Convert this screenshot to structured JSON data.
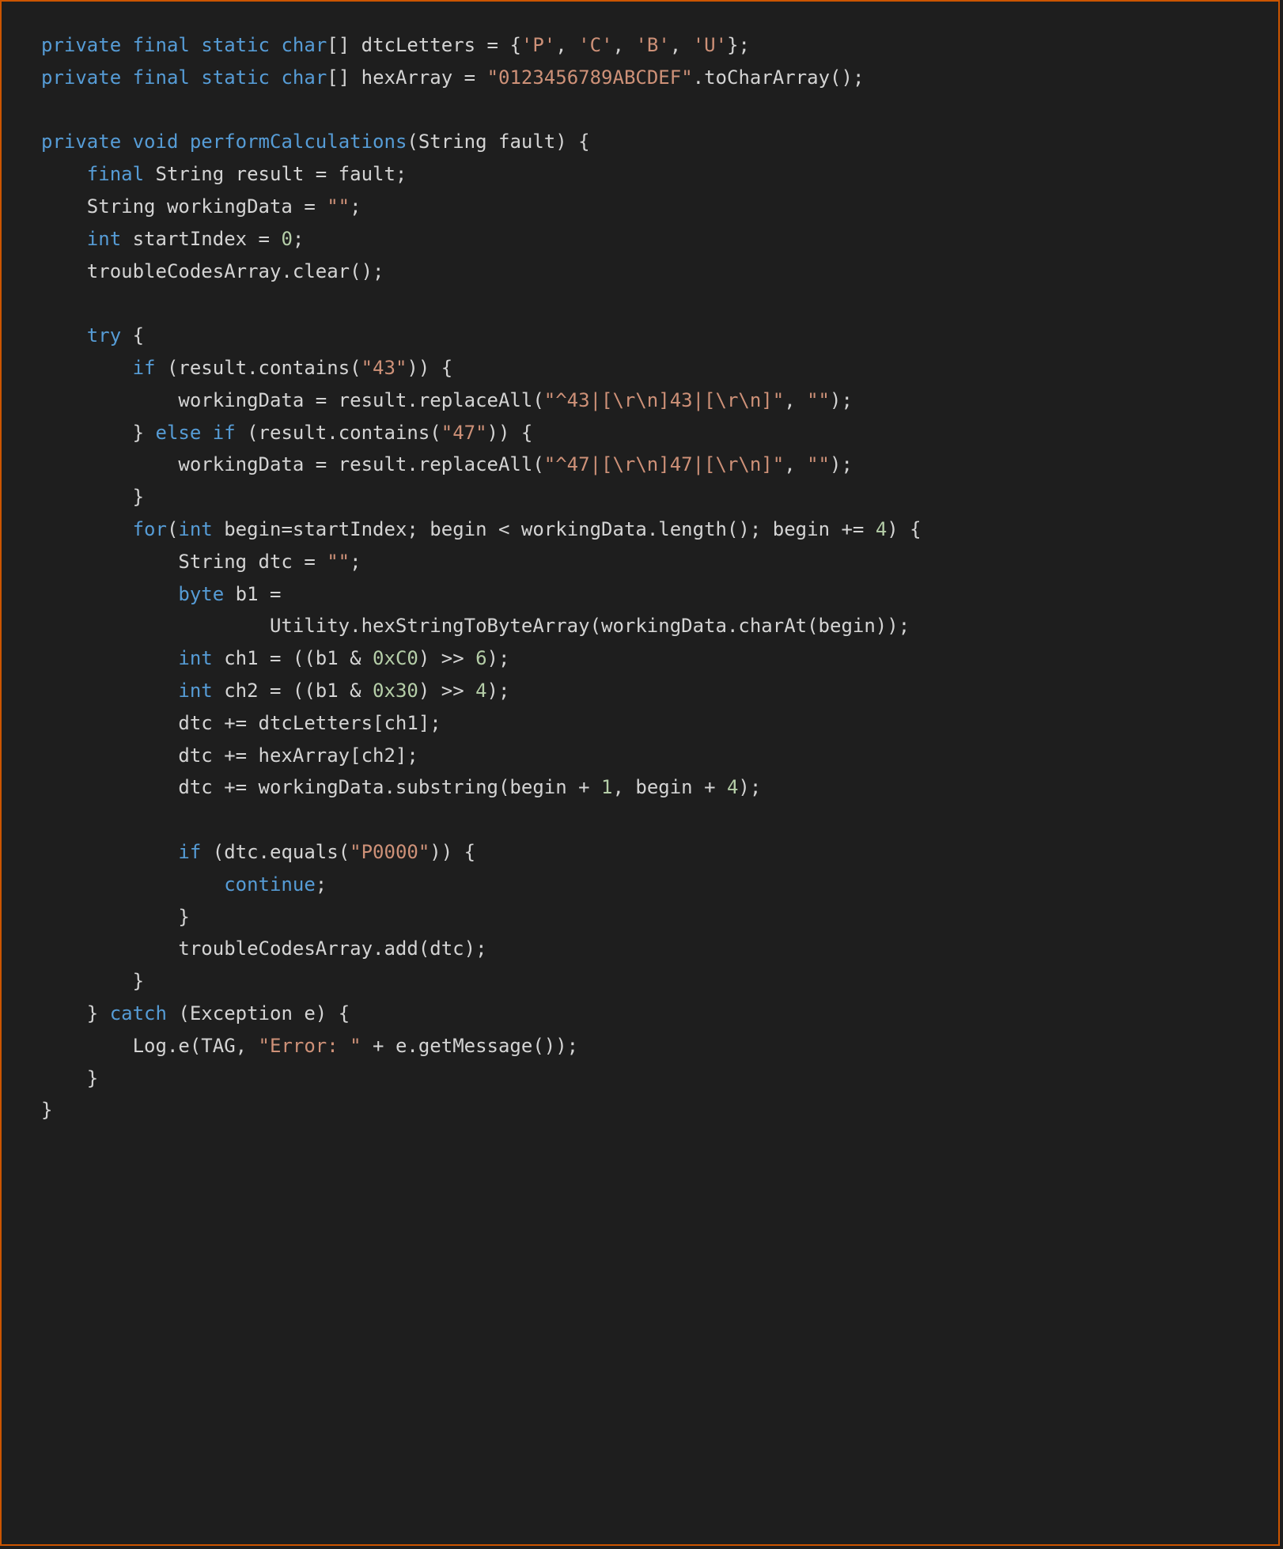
{
  "code": {
    "lines": [
      [
        {
          "t": "private",
          "c": "kw"
        },
        {
          "t": " "
        },
        {
          "t": "final",
          "c": "kw"
        },
        {
          "t": " "
        },
        {
          "t": "static",
          "c": "kw"
        },
        {
          "t": " "
        },
        {
          "t": "char",
          "c": "type"
        },
        {
          "t": "[] dtcLetters = {"
        },
        {
          "t": "'P'",
          "c": "str"
        },
        {
          "t": ", "
        },
        {
          "t": "'C'",
          "c": "str"
        },
        {
          "t": ", "
        },
        {
          "t": "'B'",
          "c": "str"
        },
        {
          "t": ", "
        },
        {
          "t": "'U'",
          "c": "str"
        },
        {
          "t": "};"
        }
      ],
      [
        {
          "t": "private",
          "c": "kw"
        },
        {
          "t": " "
        },
        {
          "t": "final",
          "c": "kw"
        },
        {
          "t": " "
        },
        {
          "t": "static",
          "c": "kw"
        },
        {
          "t": " "
        },
        {
          "t": "char",
          "c": "type"
        },
        {
          "t": "[] hexArray = "
        },
        {
          "t": "\"0123456789ABCDEF\"",
          "c": "str"
        },
        {
          "t": ".toCharArray();"
        }
      ],
      [],
      [
        {
          "t": "private",
          "c": "kw"
        },
        {
          "t": " "
        },
        {
          "t": "void",
          "c": "type"
        },
        {
          "t": " "
        },
        {
          "t": "performCalculations",
          "c": "fn-decl"
        },
        {
          "t": "(String fault) {"
        }
      ],
      [
        {
          "t": "    "
        },
        {
          "t": "final",
          "c": "kw"
        },
        {
          "t": " String result = fault;"
        }
      ],
      [
        {
          "t": "    String workingData = "
        },
        {
          "t": "\"\"",
          "c": "str"
        },
        {
          "t": ";"
        }
      ],
      [
        {
          "t": "    "
        },
        {
          "t": "int",
          "c": "type"
        },
        {
          "t": " startIndex = "
        },
        {
          "t": "0",
          "c": "num"
        },
        {
          "t": ";"
        }
      ],
      [
        {
          "t": "    troubleCodesArray.clear();"
        }
      ],
      [],
      [
        {
          "t": "    "
        },
        {
          "t": "try",
          "c": "kw"
        },
        {
          "t": " {"
        }
      ],
      [
        {
          "t": "        "
        },
        {
          "t": "if",
          "c": "kw"
        },
        {
          "t": " (result.contains("
        },
        {
          "t": "\"43\"",
          "c": "str"
        },
        {
          "t": ")) {"
        }
      ],
      [
        {
          "t": "            workingData = result.replaceAll("
        },
        {
          "t": "\"^43|[\\r\\n]43|[\\r\\n]\"",
          "c": "str"
        },
        {
          "t": ", "
        },
        {
          "t": "\"\"",
          "c": "str"
        },
        {
          "t": ");"
        }
      ],
      [
        {
          "t": "        } "
        },
        {
          "t": "else",
          "c": "kw"
        },
        {
          "t": " "
        },
        {
          "t": "if",
          "c": "kw"
        },
        {
          "t": " (result.contains("
        },
        {
          "t": "\"47\"",
          "c": "str"
        },
        {
          "t": ")) {"
        }
      ],
      [
        {
          "t": "            workingData = result.replaceAll("
        },
        {
          "t": "\"^47|[\\r\\n]47|[\\r\\n]\"",
          "c": "str"
        },
        {
          "t": ", "
        },
        {
          "t": "\"\"",
          "c": "str"
        },
        {
          "t": ");"
        }
      ],
      [
        {
          "t": "        }"
        }
      ],
      [
        {
          "t": "        "
        },
        {
          "t": "for",
          "c": "kw"
        },
        {
          "t": "("
        },
        {
          "t": "int",
          "c": "type"
        },
        {
          "t": " begin=startIndex; begin < workingData.length(); begin += "
        },
        {
          "t": "4",
          "c": "num"
        },
        {
          "t": ") {"
        }
      ],
      [
        {
          "t": "            String dtc = "
        },
        {
          "t": "\"\"",
          "c": "str"
        },
        {
          "t": ";"
        }
      ],
      [
        {
          "t": "            "
        },
        {
          "t": "byte",
          "c": "type"
        },
        {
          "t": " b1 ="
        }
      ],
      [
        {
          "t": "                    Utility.hexStringToByteArray(workingData.charAt(begin));"
        }
      ],
      [
        {
          "t": "            "
        },
        {
          "t": "int",
          "c": "type"
        },
        {
          "t": " ch1 = ((b1 & "
        },
        {
          "t": "0xC0",
          "c": "num"
        },
        {
          "t": ") >> "
        },
        {
          "t": "6",
          "c": "num"
        },
        {
          "t": ");"
        }
      ],
      [
        {
          "t": "            "
        },
        {
          "t": "int",
          "c": "type"
        },
        {
          "t": " ch2 = ((b1 & "
        },
        {
          "t": "0x30",
          "c": "num"
        },
        {
          "t": ") >> "
        },
        {
          "t": "4",
          "c": "num"
        },
        {
          "t": ");"
        }
      ],
      [
        {
          "t": "            dtc += dtcLetters[ch1];"
        }
      ],
      [
        {
          "t": "            dtc += hexArray[ch2];"
        }
      ],
      [
        {
          "t": "            dtc += workingData.substring(begin + "
        },
        {
          "t": "1",
          "c": "num"
        },
        {
          "t": ", begin + "
        },
        {
          "t": "4",
          "c": "num"
        },
        {
          "t": ");"
        }
      ],
      [],
      [
        {
          "t": "            "
        },
        {
          "t": "if",
          "c": "kw"
        },
        {
          "t": " (dtc.equals("
        },
        {
          "t": "\"P0000\"",
          "c": "str"
        },
        {
          "t": ")) {"
        }
      ],
      [
        {
          "t": "                "
        },
        {
          "t": "continue",
          "c": "kw"
        },
        {
          "t": ";"
        }
      ],
      [
        {
          "t": "            }"
        }
      ],
      [
        {
          "t": "            troubleCodesArray.add(dtc);"
        }
      ],
      [
        {
          "t": "        }"
        }
      ],
      [
        {
          "t": "    } "
        },
        {
          "t": "catch",
          "c": "kw"
        },
        {
          "t": " (Exception e) {"
        }
      ],
      [
        {
          "t": "        Log.e(TAG, "
        },
        {
          "t": "\"Error: \"",
          "c": "str"
        },
        {
          "t": " + e.getMessage());"
        }
      ],
      [
        {
          "t": "    }"
        }
      ],
      [
        {
          "t": "}"
        }
      ]
    ]
  }
}
